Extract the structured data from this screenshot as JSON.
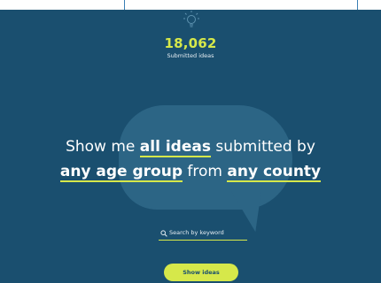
{
  "stats": {
    "count": "18,062",
    "label": "Submitted ideas"
  },
  "headline": {
    "prefix": "Show me ",
    "ideas_filter": "all ideas",
    "middle1": " submitted by",
    "age_filter": "any age group",
    "middle2": " from ",
    "county_filter": "any county"
  },
  "search": {
    "placeholder": "Search by keyword",
    "icon": "search-icon"
  },
  "actions": {
    "show_ideas": "Show ideas"
  },
  "colors": {
    "background": "#1a4f6f",
    "accent": "#d6e84a",
    "bubble": "#2c6585",
    "text": "#ffffff"
  }
}
